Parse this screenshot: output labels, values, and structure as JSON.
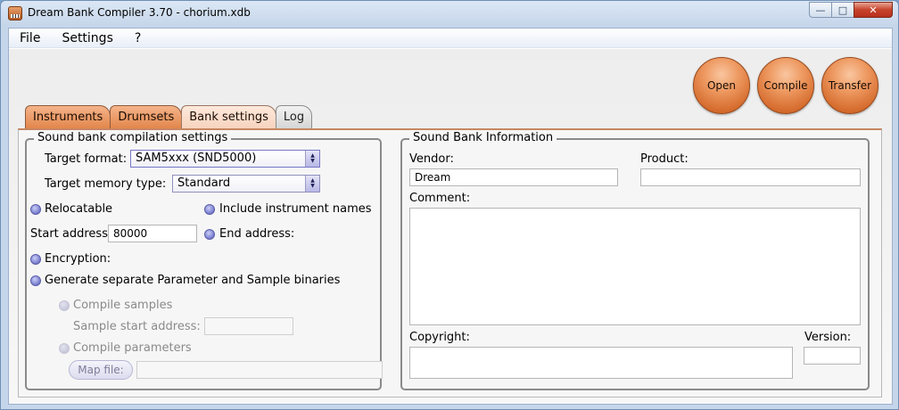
{
  "window": {
    "title": "Dream Bank Compiler 3.70 - chorium.xdb",
    "controls": {
      "minimize": "—",
      "maximize": "□",
      "close": "✕"
    }
  },
  "menu": [
    "File",
    "Settings",
    "?"
  ],
  "actions": {
    "open": "Open",
    "compile": "Compile",
    "transfer": "Transfer"
  },
  "tabs": [
    "Instruments",
    "Drumsets",
    "Bank settings",
    "Log"
  ],
  "active_tab": "Bank settings",
  "compilation": {
    "title": "Sound bank compilation settings",
    "target_format_label": "Target format:",
    "target_format_value": "SAM5xxx (SND5000)",
    "target_memory_label": "Target memory type:",
    "target_memory_value": "Standard",
    "relocatable_label": "Relocatable",
    "include_names_label": "Include instrument names",
    "start_address_label": "Start address:",
    "start_address_value": "80000",
    "end_address_label": "End address:",
    "encryption_label": "Encryption:",
    "separate_binaries_label": "Generate separate Parameter and Sample binaries",
    "compile_samples_label": "Compile samples",
    "sample_start_label": "Sample start address:",
    "sample_start_value": "",
    "compile_parameters_label": "Compile parameters",
    "map_file_label": "Map file:",
    "map_file_value": ""
  },
  "info": {
    "title": "Sound Bank Information",
    "vendor_label": "Vendor:",
    "vendor_value": "Dream",
    "product_label": "Product:",
    "product_value": "",
    "comment_label": "Comment:",
    "comment_value": "",
    "copyright_label": "Copyright:",
    "copyright_value": "",
    "version_label": "Version:",
    "version_value": ""
  },
  "colors": {
    "accent_orange": "#e2864c",
    "orb_orange": "#d66d2f",
    "radio_blue": "#6b70c8"
  }
}
